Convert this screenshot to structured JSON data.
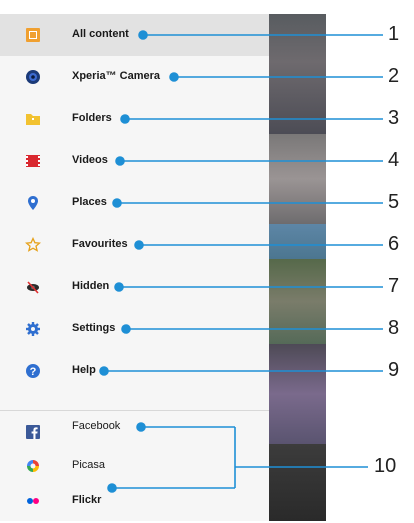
{
  "menu": {
    "items": [
      {
        "label": "All content",
        "icon": "all-content-icon",
        "selected": true
      },
      {
        "label": "Xperia™ Camera",
        "icon": "camera-icon"
      },
      {
        "label": "Folders",
        "icon": "folder-icon"
      },
      {
        "label": "Videos",
        "icon": "video-icon"
      },
      {
        "label": "Places",
        "icon": "place-pin-icon"
      },
      {
        "label": "Favourites",
        "icon": "star-icon"
      },
      {
        "label": "Hidden",
        "icon": "hidden-eye-icon"
      },
      {
        "label": "Settings",
        "icon": "gear-icon"
      },
      {
        "label": "Help",
        "icon": "help-icon"
      },
      {
        "label": "Facebook",
        "icon": "facebook-icon"
      },
      {
        "label": "Picasa",
        "icon": "picasa-icon"
      },
      {
        "label": "Flickr",
        "icon": "flickr-icon"
      }
    ]
  },
  "callouts": [
    "1",
    "2",
    "3",
    "4",
    "5",
    "6",
    "7",
    "8",
    "9",
    "10"
  ],
  "colors": {
    "accent": "#1e8fd5",
    "selected_bg": "#e2e2e2",
    "drawer_bg": "#f6f6f6"
  }
}
